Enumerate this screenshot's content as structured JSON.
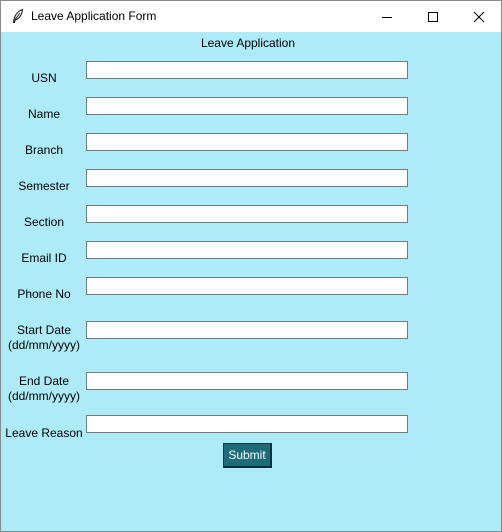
{
  "window": {
    "title": "Leave Application Form",
    "controls": [
      "minimize",
      "maximize",
      "close"
    ],
    "icons": {
      "app": "feather-icon",
      "minimize": "minimize-icon",
      "maximize": "maximize-icon",
      "close": "close-icon"
    }
  },
  "form": {
    "heading": "Leave Application",
    "background_color": "#aeebf9",
    "fields": [
      {
        "label": "USN",
        "value": ""
      },
      {
        "label": "Name",
        "value": ""
      },
      {
        "label": "Branch",
        "value": ""
      },
      {
        "label": "Semester",
        "value": ""
      },
      {
        "label": "Section",
        "value": ""
      },
      {
        "label": "Email ID",
        "value": ""
      },
      {
        "label": "Phone No",
        "value": ""
      },
      {
        "label": "Start Date",
        "label_line2": "(dd/mm/yyyy)",
        "value": ""
      },
      {
        "label": "End Date",
        "label_line2": "(dd/mm/yyyy)",
        "value": ""
      },
      {
        "label": "Leave Reason",
        "value": ""
      }
    ],
    "submit_label": "Submit",
    "submit_color": "#1e6b7a"
  }
}
